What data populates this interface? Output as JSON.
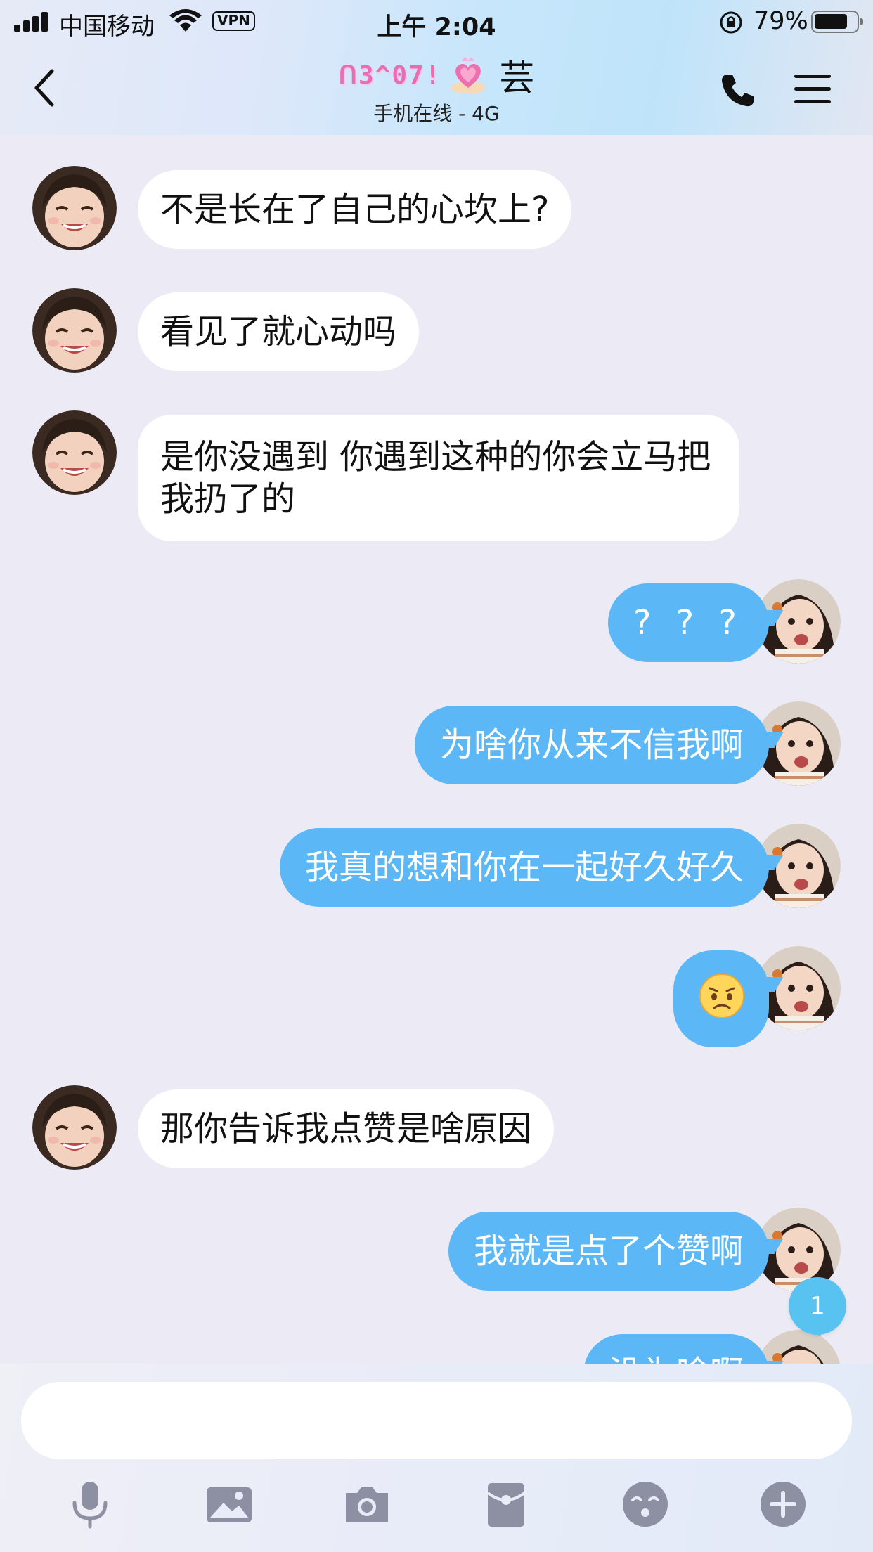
{
  "status_bar": {
    "carrier": "中国移动",
    "vpn_label": "VPN",
    "time": "上午 2:04",
    "battery_text": "79%",
    "battery_level": 0.79
  },
  "header": {
    "title_decoration": "ᑎ3^07!",
    "contact_name": "芸",
    "status": "手机在线 - 4G",
    "icons": [
      "back-chevron-icon",
      "heart-crown-icon",
      "phone-icon",
      "menu-icon"
    ]
  },
  "messages": [
    {
      "side": "in",
      "text": "不是长在了自己的心坎上?"
    },
    {
      "side": "in",
      "text": "看见了就心动吗"
    },
    {
      "side": "in",
      "text": "是你没遇到 你遇到这种的你会立马把我扔了的"
    },
    {
      "side": "out",
      "text": "? ? ?"
    },
    {
      "side": "out",
      "text": "为啥你从来不信我啊"
    },
    {
      "side": "out",
      "text": "我真的想和你在一起好久好久"
    },
    {
      "side": "out",
      "text": "",
      "emoji": "disappointed-face-emoji"
    },
    {
      "side": "in",
      "text": "那你告诉我点赞是啥原因"
    },
    {
      "side": "out",
      "text": "我就是点了个赞啊"
    },
    {
      "side": "out",
      "text": "没为啥啊"
    }
  ],
  "unread_badge": "1",
  "input": {
    "placeholder": "",
    "value": ""
  },
  "toolbar": [
    "microphone-icon",
    "image-icon",
    "camera-icon",
    "red-packet-icon",
    "emoji-icon",
    "plus-icon"
  ],
  "colors": {
    "outgoing_bubble": "#5BB7F5",
    "incoming_bubble": "#FFFFFF",
    "chat_background": "#ECEBF5",
    "toolbar_icon": "#8D8FA3"
  }
}
